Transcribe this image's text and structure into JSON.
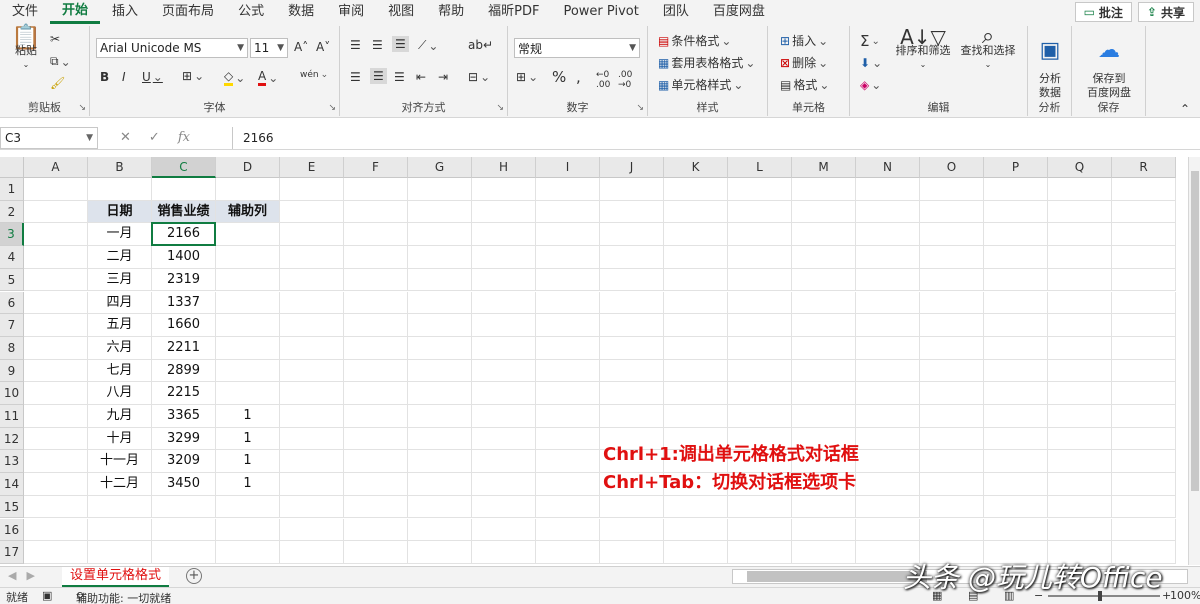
{
  "menu": {
    "tabs": [
      "文件",
      "开始",
      "插入",
      "页面布局",
      "公式",
      "数据",
      "审阅",
      "视图",
      "帮助",
      "福昕PDF",
      "Power Pivot",
      "团队",
      "百度网盘"
    ],
    "active_index": 1,
    "comment_label": "批注",
    "share_label": "共享"
  },
  "ribbon": {
    "clipboard": {
      "label": "剪贴板",
      "paste": "粘贴"
    },
    "font": {
      "label": "字体",
      "name": "Arial Unicode MS",
      "size": "11",
      "bold": "B",
      "italic": "I",
      "underline": "U",
      "grow": "A˄",
      "shrink": "A˅",
      "phonetic": "wén"
    },
    "alignment": {
      "label": "对齐方式"
    },
    "number": {
      "label": "数字",
      "format": "常规"
    },
    "styles": {
      "label": "样式",
      "conditional": "条件格式",
      "table": "套用表格格式",
      "cell_styles": "单元格样式"
    },
    "cells": {
      "label": "单元格",
      "insert": "插入",
      "delete": "删除",
      "format": "格式"
    },
    "editing": {
      "label": "编辑",
      "sort": "排序和筛选",
      "find": "查找和选择",
      "sigma": "Σ"
    },
    "analysis": {
      "label": "分析",
      "analyze": "分析\n数据"
    },
    "save": {
      "label": "保存",
      "save_to": "保存到\n百度网盘"
    }
  },
  "formula_bar": {
    "name_box": "C3",
    "fx": "fx",
    "value": "2166"
  },
  "grid": {
    "columns": [
      "A",
      "B",
      "C",
      "D",
      "E",
      "F",
      "G",
      "H",
      "I",
      "J",
      "K",
      "L",
      "M",
      "N",
      "O",
      "P",
      "Q",
      "R"
    ],
    "rows": [
      "1",
      "2",
      "3",
      "4",
      "5",
      "6",
      "7",
      "8",
      "9",
      "10",
      "11",
      "12",
      "13",
      "14",
      "15",
      "16",
      "17"
    ],
    "selected_column": "C",
    "selected_row": "3",
    "table_header": [
      "日期",
      "销售业绩",
      "辅助列"
    ],
    "table_rows": [
      [
        "一月",
        "2166",
        ""
      ],
      [
        "二月",
        "1400",
        ""
      ],
      [
        "三月",
        "2319",
        ""
      ],
      [
        "四月",
        "1337",
        ""
      ],
      [
        "五月",
        "1660",
        ""
      ],
      [
        "六月",
        "2211",
        ""
      ],
      [
        "七月",
        "2899",
        ""
      ],
      [
        "八月",
        "2215",
        ""
      ],
      [
        "九月",
        "3365",
        "1"
      ],
      [
        "十月",
        "3299",
        "1"
      ],
      [
        "十一月",
        "3209",
        "1"
      ],
      [
        "十二月",
        "3450",
        "1"
      ]
    ]
  },
  "annotations": [
    "Chrl+1:调出单元格格式对话框",
    "Chrl+Tab：切换对话框选项卡"
  ],
  "sheet_tab": "设置单元格格式",
  "status": {
    "ready": "就绪",
    "accessibility": "辅助功能: 一切就绪",
    "zoom": "100%"
  },
  "watermark": "头条 @玩儿转Office",
  "colors": {
    "accent": "#107c41",
    "annotation": "#e01010",
    "table_header_bg": "#dde3ec"
  }
}
